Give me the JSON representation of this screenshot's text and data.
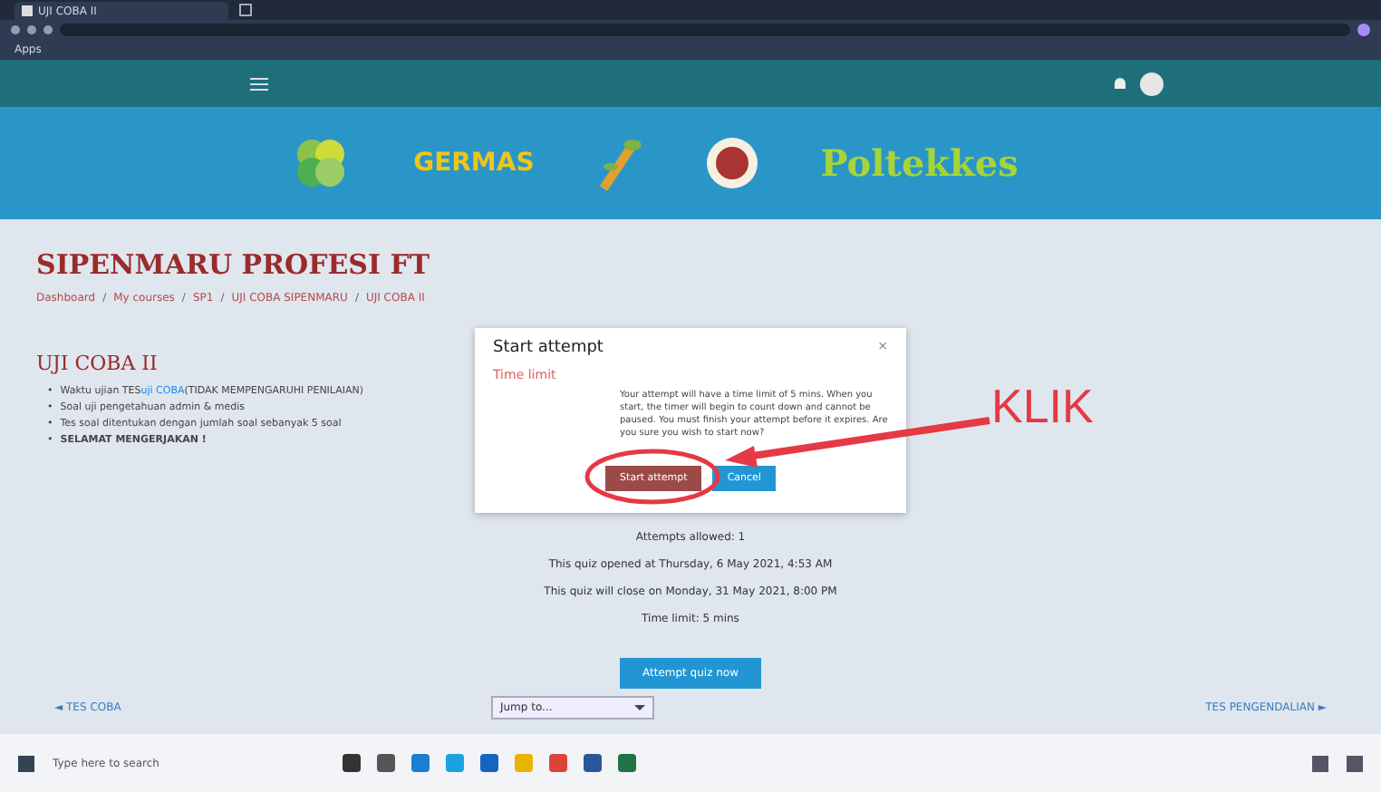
{
  "browser": {
    "tab_title": "UJI COBA II",
    "bookmarks": [
      "Apps"
    ]
  },
  "banner": {
    "logos": [
      {
        "kind": "kemenkes"
      },
      {
        "kind": "germas",
        "text": "GERMAS"
      },
      {
        "kind": "plant"
      },
      {
        "kind": "seal"
      },
      {
        "kind": "wordmark",
        "text": "Poltekkes"
      }
    ]
  },
  "course_title": "SIPENMARU PROFESI FT",
  "breadcrumb": [
    "Dashboard",
    "My courses",
    "SP1",
    "UJI COBA SIPENMARU",
    "UJI COBA II"
  ],
  "breadcrumb_separator": "/",
  "quiz": {
    "title": "UJI COBA II",
    "bullet_marker": "•",
    "bullets": [
      {
        "text": "Waktu ujian TES",
        "link": "uji COBA",
        "after": "(TIDAK MEMPENGARUHI PENILAIAN)",
        "bold": false
      },
      {
        "text": "Soal uji pengetahuan admin & medis",
        "bold": false
      },
      {
        "text": "Tes soal ditentukan dengan jumlah soal sebanyak 5 soal",
        "bold": false
      },
      {
        "text": "SELAMAT MENGERJAKAN !",
        "bold": true
      }
    ],
    "info": [
      "Attempts allowed: 1",
      "This quiz opened at Thursday, 6 May 2021, 4:53 AM",
      "This quiz will close on Monday, 31 May 2021, 8:00 PM",
      "Time limit: 5 mins"
    ],
    "button": "Attempt quiz now"
  },
  "dialog": {
    "title": "Start attempt",
    "close": "×",
    "section": "Time limit",
    "message": "Your attempt will have a time limit of 5 mins. When you start, the timer will begin to count down and cannot be paused. You must finish your attempt before it expires. Are you sure you wish to start now?",
    "buttons": [
      {
        "label": "Start attempt",
        "kind": "primary"
      },
      {
        "label": "Cancel",
        "kind": "secondary"
      }
    ]
  },
  "annotation": {
    "text": "KLIK"
  },
  "footer_nav": {
    "previous": "◄ TES COBA",
    "jump": "Jump to...",
    "next": "TES PENGENDALIAN ►"
  },
  "taskbar": {
    "search_placeholder": "Type here to search"
  }
}
